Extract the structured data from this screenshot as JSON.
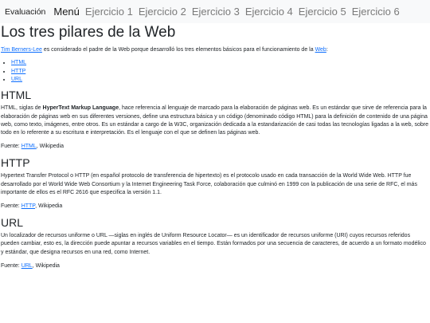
{
  "navbar": {
    "brand": "Evaluación",
    "items": [
      "Menú",
      "Ejercicio 1",
      "Ejercicio 2",
      "Ejercicio 3",
      "Ejercicio 4",
      "Ejercicio 5",
      "Ejercicio 6"
    ]
  },
  "page": {
    "title": "Los tres pilares de la Web",
    "intro": {
      "author_link": "Tim Berners-Lee",
      "text": " es considerado el padre de la Web porque desarrolló los tres elementos básicos para el funcionamiento de la ",
      "web_link": "Web",
      "end": ":"
    },
    "list": [
      "HTML",
      "HTTP",
      "URL"
    ]
  },
  "sections": [
    {
      "heading": "HTML",
      "text_pre": "HTML, siglas de ",
      "text_bold": "HyperText Markup Language",
      "text_post": ", hace referencia al lenguaje de marcado para la elaboración de páginas web. Es un estándar que sirve de referencia para la elaboración de páginas web en sus diferentes versiones, define una estructura básica y un código (denominado código HTML) para la definición de contenido de una página web, como texto, imágenes, entre otros. Es un estándar a cargo de la W3C, organización dedicada a la estandarización de casi todas las tecnologías ligadas a la web, sobre todo en lo referente a su escritura e interpretación. Es el lenguaje con el que se definen las páginas web.",
      "source_label": "Fuente: ",
      "source_link": "HTML",
      "source_suffix": ", Wikipedia"
    },
    {
      "heading": "HTTP",
      "text": "Hypertext Transfer Protocol o HTTP (en español protocolo de transferencia de hipertexto) es el protocolo usado en cada transacción de la World Wide Web. HTTP fue desarrollado por el World Wide Web Consortium y la Internet Engineering Task Force, colaboración que culminó en 1999 con la publicación de una serie de RFC, el más importante de ellos es el RFC 2616 que especifica la versión 1.1.",
      "source_label": "Fuente: ",
      "source_link": "HTTP",
      "source_suffix": ", Wikipedia"
    },
    {
      "heading": "URL",
      "text": "Un localizador de recursos uniforme o URL —siglas en inglés de Uniform Resource Locator— es un identificador de recursos uniforme (URI) cuyos recursos referidos pueden cambiar, esto es, la dirección puede apuntar a recursos variables en el tiempo. Están formados por una secuencia de caracteres, de acuerdo a un formato modélico y estándar, que designa recursos en una red, como Internet.",
      "source_label": "Fuente: ",
      "source_link": "URL",
      "source_suffix": ", Wikipedia"
    }
  ]
}
